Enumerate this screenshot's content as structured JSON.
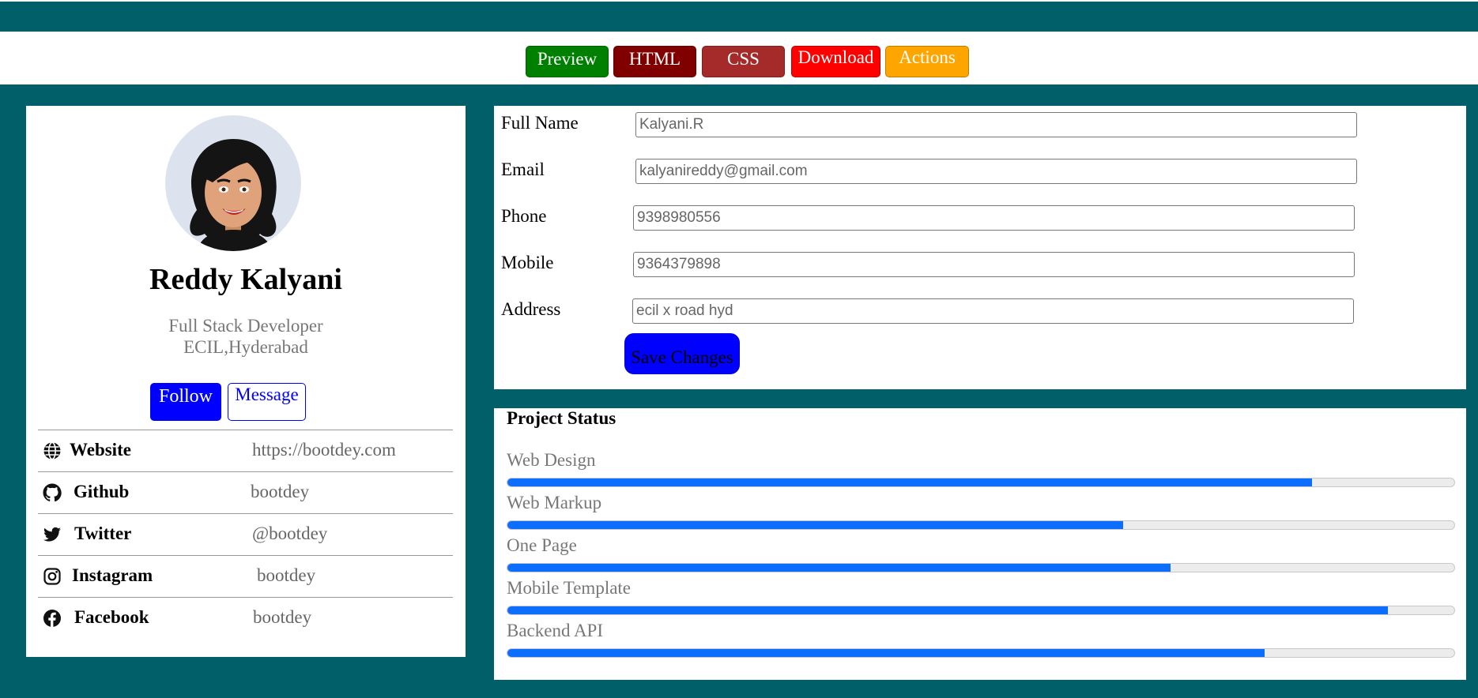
{
  "toolbar": {
    "buttons": [
      {
        "label": "Preview",
        "color": "#008000"
      },
      {
        "label": "HTML",
        "color": "#800000"
      },
      {
        "label": "CSS",
        "color": "#a52a2a"
      },
      {
        "label": "Download",
        "color": "#ff0000"
      },
      {
        "label": "Actions",
        "color": "#ffa500"
      }
    ]
  },
  "profile": {
    "name": "Reddy Kalyani",
    "role": "Full Stack Developer",
    "location": "ECIL,Hyderabad",
    "follow_label": "Follow",
    "message_label": "Message",
    "social": [
      {
        "icon": "globe-icon",
        "label": "Website",
        "value": "https://bootdey.com"
      },
      {
        "icon": "github-icon",
        "label": "Github",
        "value": "bootdey"
      },
      {
        "icon": "twitter-icon",
        "label": "Twitter",
        "value": "@bootdey"
      },
      {
        "icon": "instagram-icon",
        "label": "Instagram",
        "value": "bootdey"
      },
      {
        "icon": "facebook-icon",
        "label": "Facebook",
        "value": "bootdey"
      }
    ]
  },
  "form": {
    "fields": [
      {
        "label": "Full Name",
        "value": "Kalyani.R"
      },
      {
        "label": "Email",
        "value": "kalyanireddy@gmail.com"
      },
      {
        "label": "Phone",
        "value": "9398980556"
      },
      {
        "label": "Mobile",
        "value": "9364379898"
      },
      {
        "label": "Address",
        "value": "ecil x road hyd"
      }
    ],
    "save_label": "Save Changes"
  },
  "status": {
    "title": "Project Status",
    "projects": [
      {
        "label": "Web Design",
        "progress": 85
      },
      {
        "label": "Web Markup",
        "progress": 65
      },
      {
        "label": "One Page",
        "progress": 70
      },
      {
        "label": "Mobile Template",
        "progress": 93
      },
      {
        "label": "Backend API",
        "progress": 80
      }
    ]
  },
  "colors": {
    "background": "#005f69",
    "primary": "#0000ff",
    "progress": "#0d6efd"
  }
}
